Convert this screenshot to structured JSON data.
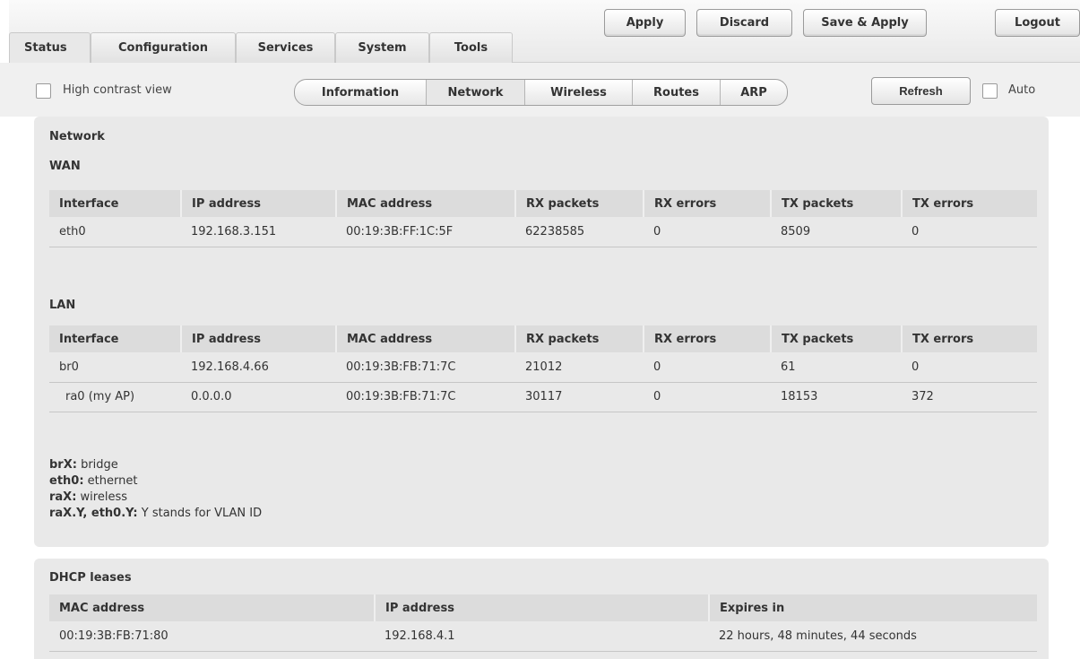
{
  "top_tabs": [
    "Status",
    "Configuration",
    "Services",
    "System",
    "Tools"
  ],
  "actions": {
    "apply": "Apply",
    "discard": "Discard",
    "save_apply": "Save & Apply",
    "logout": "Logout"
  },
  "subbar": {
    "high_contrast_label": "High contrast view",
    "subtabs": [
      "Information",
      "Network",
      "Wireless",
      "Routes",
      "ARP"
    ],
    "refresh": "Refresh",
    "auto_label": "Auto"
  },
  "network": {
    "title": "Network",
    "wan_title": "WAN",
    "lan_title": "LAN",
    "columns": [
      "Interface",
      "IP address",
      "MAC address",
      "RX packets",
      "RX errors",
      "TX packets",
      "TX errors"
    ],
    "wan_rows": [
      [
        "eth0",
        "192.168.3.151",
        "00:19:3B:FF:1C:5F",
        "62238585",
        "0",
        "8509",
        "0"
      ]
    ],
    "lan_rows": [
      [
        "br0",
        "192.168.4.66",
        "00:19:3B:FB:71:7C",
        "21012",
        "0",
        "61",
        "0"
      ],
      [
        "ra0 (my AP)",
        "0.0.0.0",
        "00:19:3B:FB:71:7C",
        "30117",
        "0",
        "18153",
        "372"
      ]
    ],
    "legend": [
      {
        "key": "brX:",
        "value": " bridge"
      },
      {
        "key": "eth0:",
        "value": " ethernet"
      },
      {
        "key": "raX:",
        "value": " wireless"
      },
      {
        "key": "raX.Y, eth0.Y:",
        "value": " Y stands for VLAN ID"
      }
    ]
  },
  "dhcp": {
    "title": "DHCP leases",
    "columns": [
      "MAC address",
      "IP address",
      "Expires in"
    ],
    "rows": [
      [
        "00:19:3B:FB:71:80",
        "192.168.4.1",
        "22 hours, 48 minutes, 44 seconds"
      ]
    ]
  }
}
